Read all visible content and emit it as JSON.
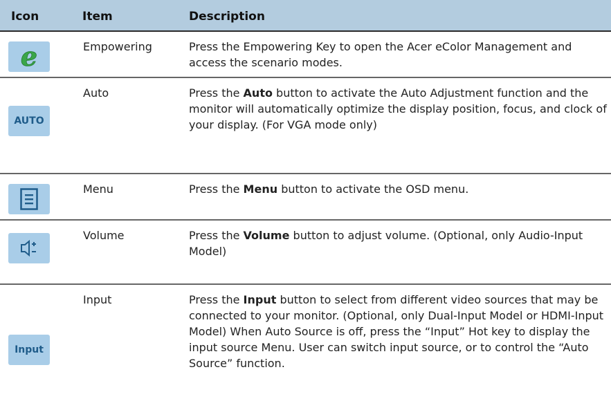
{
  "header": {
    "icon": "Icon",
    "item": "Item",
    "description": "Description"
  },
  "rows": [
    {
      "icon": "e-icon",
      "item": "Empowering",
      "text": "Press the Empowering Key to open the Acer eColor Management and access the scenario modes."
    },
    {
      "icon_text": "AUTO",
      "item": "Auto",
      "pre": "Press the ",
      "bold": "Auto",
      "post": " button to activate the Auto Adjustment function and the monitor will automatically optimize the display position, focus, and clock of your display. (For VGA mode only)"
    },
    {
      "icon": "menu-icon",
      "item": "Menu",
      "pre": "Press the ",
      "bold": "Menu",
      "post": " button to activate the OSD menu."
    },
    {
      "icon": "volume-icon",
      "item": "Volume",
      "pre": "Press the ",
      "bold": "Volume",
      "post": " button to adjust volume. (Optional, only Audio-Input Model)"
    },
    {
      "icon_text": "Input",
      "item": "Input",
      "pre": "Press the ",
      "bold": "Input",
      "post": " button to select from different video sources that may be connected to your monitor. (Optional, only Dual-Input Model or HDMI-Input Model) When Auto Source is off, press the “Input” Hot key to display the input source Menu. User can switch input source, or to control the “Auto Source” function."
    }
  ],
  "colors": {
    "header_bg": "#b3ccdf",
    "button_bg": "#a9cde8",
    "icon_blue": "#1f5c8a",
    "e_green": "#3aa648"
  }
}
